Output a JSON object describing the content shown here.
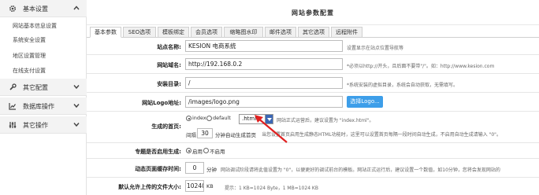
{
  "sidebar": {
    "sections": [
      {
        "label": "基本设置",
        "icon": "gear-icon",
        "expanded": true
      },
      {
        "label": "其它配置",
        "icon": "wrench-icon",
        "expanded": false
      },
      {
        "label": "数据库操作",
        "icon": "chart-icon",
        "expanded": false
      },
      {
        "label": "其它操作",
        "icon": "sliders-icon",
        "expanded": false
      }
    ],
    "items": [
      "网站基本信息设置",
      "系统安全设置",
      "地区设置管理",
      "在线支付设置"
    ]
  },
  "header": {
    "title": "网站参数配置"
  },
  "tabs": [
    "基本参数",
    "SEO选项",
    "模板绑定",
    "会员选项",
    "缩略图水印",
    "邮件选项",
    "其它选项",
    "远程附件"
  ],
  "form": {
    "site_name": {
      "label": "站点名称:",
      "value": "KESION 电商系统",
      "hint": "设置显示在站点位置导航等"
    },
    "site_url": {
      "label": "网站域名:",
      "value": "http://192.168.0.2",
      "hint": "*必须以http://开头，且后面不要带\"/\"。如：http://www.kesion.com"
    },
    "install_dir": {
      "label": "安装目录:",
      "value": "/",
      "hint": "*系统安装的虚拟目录，系统会自动获取，无需填写。"
    },
    "logo": {
      "label": "网站Logo地址:",
      "value": "/images/logo.png",
      "button": "选择Logo..."
    },
    "homepage": {
      "label": "生成的首页:",
      "radio_index": "index",
      "radio_default": "default",
      "ext_value": ".html",
      "hint_line1": "网站正式运营后，建议设置为 \"index.html\"。",
      "interval_prefix": "间隔",
      "interval_value": "30",
      "interval_suffix": "分钟自动生成首页",
      "hint_line2": "当您设置首页启用生成静态HTML功能时，这里可以设置首页每隔一段时间自动生成，不启用自动生成请输入 \"0\"。"
    },
    "topic_gen": {
      "label": "专题是否启用生成:",
      "option_on": "启用",
      "option_off": "不启用"
    },
    "cache_time": {
      "label": "动态页面缓存时间:",
      "value": "0",
      "unit": "分钟",
      "hint": "网站调试阶段请将此值设置为 \"0\"，以便更好的调试前台的模板。网站正式运行后，建议设置一个数值，如10分钟，您将会发现网站的"
    },
    "max_upload": {
      "label": "默认允许上传的文件大小:",
      "value": "10240",
      "unit": "KB",
      "hint": "提示：1 KB=1024 Byte，1 MB=1024 KB"
    }
  }
}
